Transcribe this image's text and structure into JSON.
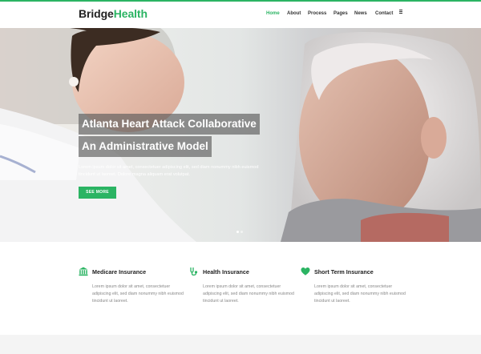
{
  "brand": {
    "name_part1": "Bridge",
    "name_part2": "Health",
    "accent": "#2bb463"
  },
  "nav": {
    "items": [
      "Home",
      "About",
      "Process",
      "Pages",
      "News",
      "Contact"
    ],
    "active": "Home",
    "menu_icon": "hamburger-menu-icon"
  },
  "hero": {
    "title_line1": "Atlanta Heart Attack Collaborative",
    "title_line2": "An Administrative Model",
    "description": "Lorem ipsum dolor sit amet, consectetuer adipiscing elit, sed diam nonummy nibh euismod tincidunt ut laoreet. Dolore magna aliquam erat volutpat.",
    "button": "SEE MORE",
    "slides": 2,
    "active_slide": 1
  },
  "features": [
    {
      "icon": "bank-icon",
      "title": "Medicare Insurance",
      "text": "Lorem ipsum dolor sit amet, consectetuer adipiscing elit, sed diam nonummy nibh euismod tincidunt ut laoreet."
    },
    {
      "icon": "stethoscope-icon",
      "title": "Health Insurance",
      "text": "Lorem ipsum dolor sit amet, consectetuer adipiscing elit, sed diam nonummy nibh euismod tincidunt ut laoreet."
    },
    {
      "icon": "heart-icon",
      "title": "Short Term Insurance",
      "text": "Lorem ipsum dolor sit amet, consectetuer adipiscing elit, sed diam nonummy nibh euismod tincidunt ut laoreet."
    }
  ]
}
